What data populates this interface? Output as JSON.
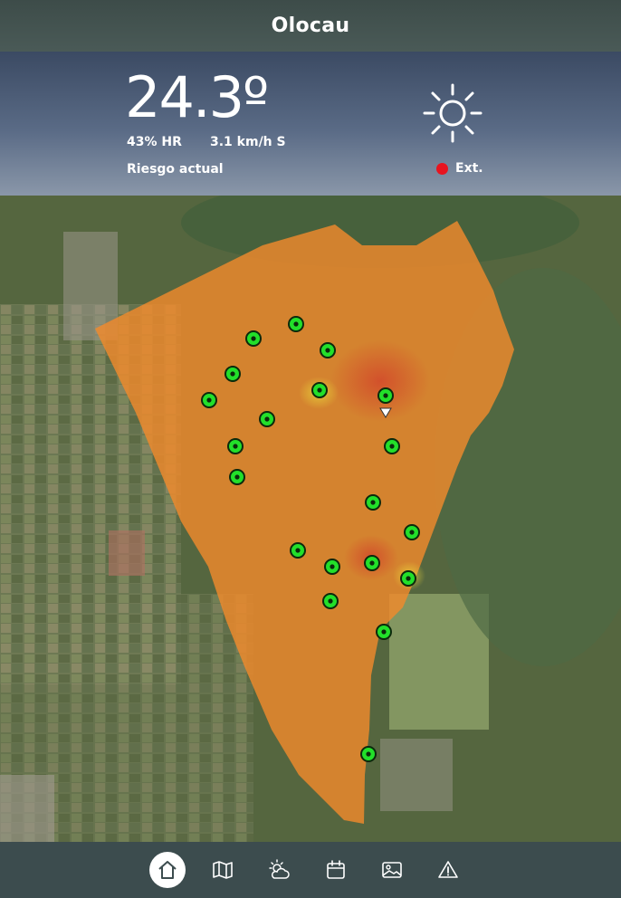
{
  "header": {
    "title": "Olocau"
  },
  "weather": {
    "temperature": "24.3º",
    "humidity": "43% HR",
    "wind": "3.1 km/h S",
    "risk_label": "Riesgo actual",
    "risk_value": "Ext.",
    "risk_color": "#e8141f",
    "condition_icon": "sun-icon"
  },
  "map": {
    "risk_area_color": "#f08a2c",
    "marker_color": "#22e02a",
    "marker_count": 20,
    "has_location_pointer": true
  },
  "nav": {
    "items": [
      {
        "name": "home-icon",
        "active": true
      },
      {
        "name": "map-icon",
        "active": false
      },
      {
        "name": "weather-icon",
        "active": false
      },
      {
        "name": "calendar-icon",
        "active": false
      },
      {
        "name": "gallery-icon",
        "active": false
      },
      {
        "name": "warning-icon",
        "active": false
      }
    ]
  }
}
